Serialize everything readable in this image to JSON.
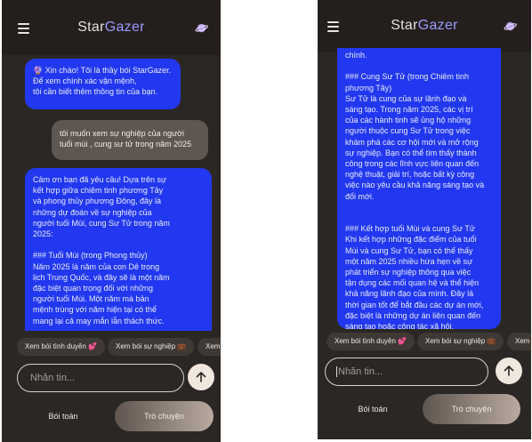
{
  "app": {
    "title_part1": "Star",
    "title_part2": "Gazer"
  },
  "screen_left": {
    "messages": [
      {
        "role": "bot",
        "text": "🔮 Xin chào! Tôi là thầy bói StarGazer.\nĐể xem chính xác vận mệnh,\ntôi cần biết thêm thông tin của bạn."
      },
      {
        "role": "user",
        "text": "tôi muốn xem sự nghiệp của người\ntuổi mùi , cung sư tử trong năm 2025"
      },
      {
        "role": "bot",
        "text": "Cảm ơn bạn đã yêu cầu! Dựa trên sự\nkết hợp giữa chiêm tinh phương Tây\nvà phong thủy phương Đông, đây là\nnhững dự đoán về sự nghiệp của\nngười tuổi Mùi, cung Sư Tử trong năm\n2025:\n\n### Tuổi Mùi (trong Phong thủy)\nNăm 2025 là năm của con Dê trong\nlịch Trung Quốc, và đây sẽ là một năm\nđặc biệt quan trọng đối với những\nngười tuổi Mùi. Một năm mà bản\nmệnh trùng với năm hiện tại có thể\nmang lại cả may mắn lẫn thách thức."
      }
    ]
  },
  "screen_right": {
    "messages": [
      {
        "role": "bot",
        "text": "chính.\n\n### Cung Sư Tử (trong Chiêm tinh\nphương Tây)\nSư Tử là cung của sự lãnh đạo và\nsáng tạo. Trong năm 2025, các vị trí\ncủa các hành tinh sẽ ủng hộ những\nngười thuộc cung Sư Tử trong việc\nkhám phá các cơ hội mới và mở rộng\nsự nghiệp. Bạn có thể tìm thấy thành\ncông trong các lĩnh vực liên quan đến\nnghệ thuật, giải trí, hoặc bất kỳ công\nviệc nào yêu cầu khả năng sáng tạo và\nđổi mới.\n\n\n### Kết hợp tuổi Mùi và cung Sư Tử\nKhi kết hợp những đặc điểm của tuổi\nMùi và cung Sư Tử, bạn có thể thấy\nmột năm 2025 nhiều hứa hẹn về sự\nphát triển sự nghiệp thông qua việc\ntận dụng các mối quan hệ và thể hiện\nkhả năng lãnh đạo của mình. Đây là\nthời gian tốt để bắt đầu các dự án mới,\nđặc biệt là những dự án liên quan đến\nsáng tạo hoặc công tác xã hội."
      }
    ]
  },
  "suggestions": [
    "Xem bói tình duyên 💕",
    "Xem bói sự nghiệp 💼",
    "Xem"
  ],
  "input": {
    "placeholder": "Nhắn tin..."
  },
  "tabs": {
    "fortune": "Bói toán",
    "chat": "Trò chuyện"
  },
  "colors": {
    "bot_bubble": "#2238f0",
    "user_bubble": "#5d5651",
    "background": "#2b2724"
  },
  "icons": {
    "menu": "menu-icon",
    "brand": "planet-icon",
    "send": "arrow-up-icon"
  }
}
